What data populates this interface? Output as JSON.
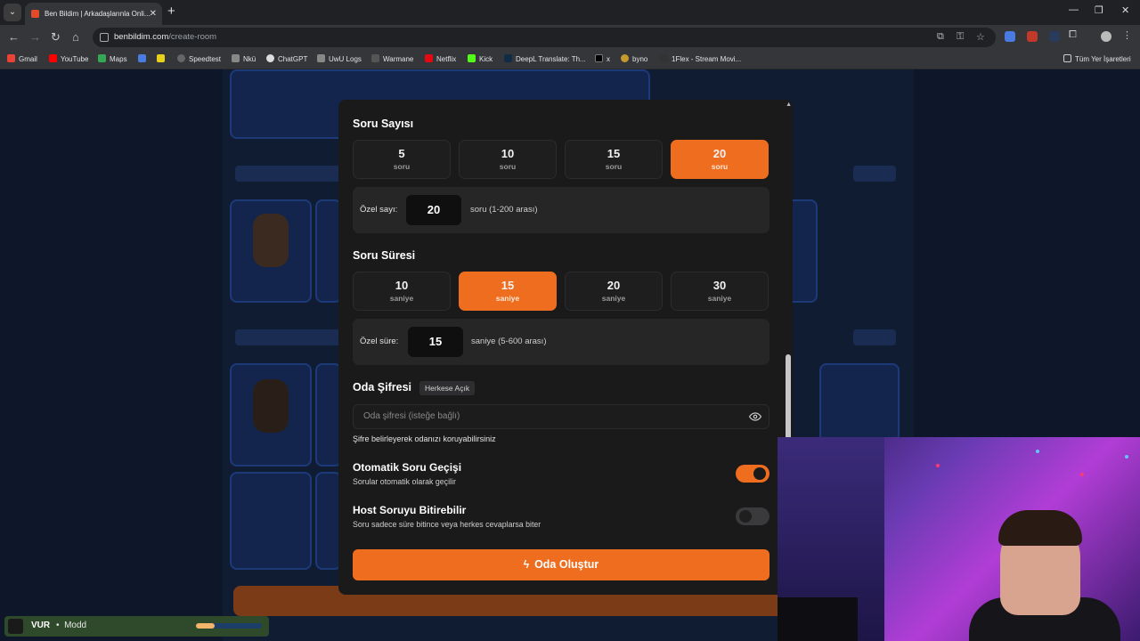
{
  "browser": {
    "tab_title": "Ben Bildim | Arkadaşlarınla Onli...",
    "url_host": "benbildim.com",
    "url_path": "/create-room",
    "bookmarks": [
      "Gmail",
      "YouTube",
      "Maps",
      "Speedtest",
      "Nkü",
      "ChatGPT",
      "UwU Logs",
      "Warmane",
      "Netflix",
      "Kick",
      "DeepL Translate: Th...",
      "x",
      "byno",
      "1Flex - Stream Movi..."
    ],
    "all_bookmarks": "Tüm Yer İşaretleri"
  },
  "modal": {
    "question_count": {
      "title": "Soru Sayısı",
      "options": [
        {
          "value": "5",
          "unit": "soru"
        },
        {
          "value": "10",
          "unit": "soru"
        },
        {
          "value": "15",
          "unit": "soru"
        },
        {
          "value": "20",
          "unit": "soru"
        }
      ],
      "selected": "20",
      "custom_label": "Özel sayı:",
      "custom_value": "20",
      "custom_hint": "soru (1-200 arası)"
    },
    "question_time": {
      "title": "Soru Süresi",
      "options": [
        {
          "value": "10",
          "unit": "saniye"
        },
        {
          "value": "15",
          "unit": "saniye"
        },
        {
          "value": "20",
          "unit": "saniye"
        },
        {
          "value": "30",
          "unit": "saniye"
        }
      ],
      "selected": "15",
      "custom_label": "Özel süre:",
      "custom_value": "15",
      "custom_hint": "saniye (5-600 arası)"
    },
    "password": {
      "title": "Oda Şifresi",
      "badge": "Herkese Açık",
      "placeholder": "Oda şifresi (isteğe bağlı)",
      "help": "Şifre belirleyerek odanızı koruyabilirsiniz"
    },
    "auto_next": {
      "title": "Otomatik Soru Geçişi",
      "subtitle": "Sorular otomatik olarak geçilir",
      "enabled": true
    },
    "host_end": {
      "title": "Host Soruyu Bitirebilir",
      "subtitle": "Soru sadece süre bitince veya herkes cevaplarsa biter",
      "enabled": false
    },
    "create_label": "Oda Oluştur"
  },
  "overlay": {
    "name": "VUR",
    "separator": "•",
    "subtitle": "Modd",
    "progress": 0.28
  },
  "colors": {
    "accent": "#ef6d1e",
    "modal_bg": "#1a1a1b",
    "page_bg": "#0e1729"
  }
}
